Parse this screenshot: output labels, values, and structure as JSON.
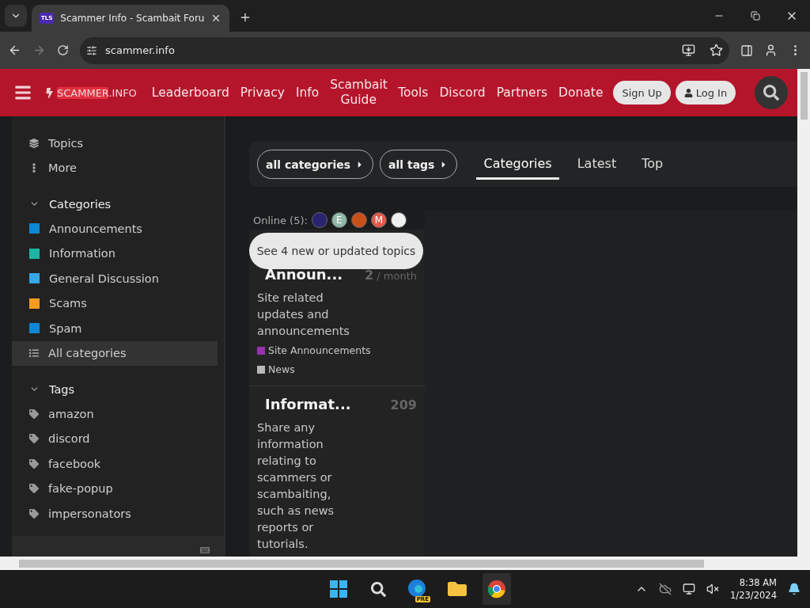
{
  "browser": {
    "tab": {
      "favicon": "TLS",
      "title": "Scammer Info - Scambait Foru",
      "selected": true
    },
    "url": "scammer.info"
  },
  "header": {
    "logo": {
      "highlight": "SCAMMER",
      "rest": ".INFO"
    },
    "nav": [
      "Leaderboard",
      "Privacy",
      "Info",
      "Scambait Guide",
      "Tools",
      "Discord",
      "Partners",
      "Donate"
    ],
    "buttons": [
      {
        "kind": "plain",
        "label": "Sign Up"
      },
      {
        "kind": "user",
        "label": "Log In"
      }
    ]
  },
  "sidebar": {
    "top": [
      {
        "kind": "layers",
        "label": "Topics"
      },
      {
        "kind": "more",
        "label": "More"
      }
    ],
    "categories": {
      "title": "Categories",
      "expanded": true,
      "items": [
        {
          "label": "Announcements",
          "color": "#0e87d6",
          "selected": false
        },
        {
          "label": "Information",
          "color": "#1fb5a4",
          "selected": false
        },
        {
          "label": "General Discussion",
          "color": "#34a8e8",
          "selected": false
        },
        {
          "label": "Scams",
          "color": "#f79a1e",
          "selected": false
        },
        {
          "label": "Spam",
          "color": "#0e87d6",
          "selected": false
        },
        {
          "label": "All categories",
          "kind": "list",
          "selected": true
        }
      ]
    },
    "tags": {
      "title": "Tags",
      "expanded": true,
      "items": [
        "amazon",
        "discord",
        "facebook",
        "fake-popup",
        "impersonators"
      ]
    }
  },
  "filters": [
    {
      "label": "all categories"
    },
    {
      "label": "all tags"
    }
  ],
  "tabs": [
    {
      "label": "Categories",
      "selected": true
    },
    {
      "label": "Latest",
      "selected": false
    },
    {
      "label": "Top",
      "selected": false
    }
  ],
  "online": {
    "label": "Online (5):",
    "avatars": [
      {
        "kind": "picture",
        "color": "#2a2470"
      },
      {
        "kind": "letter",
        "letter": "E",
        "color": "#8fb8a8"
      },
      {
        "kind": "picture",
        "color": "#c8501a"
      },
      {
        "kind": "letter",
        "letter": "M",
        "color": "#e45a4a"
      },
      {
        "kind": "picture",
        "color": "#f0f0f0"
      }
    ]
  },
  "notice": "See 4 new or updated topics",
  "cards": [
    {
      "title": "Announ...",
      "count": "2",
      "unit": "/ month",
      "description": "Site related updates and announcements",
      "subcategories": [
        {
          "label": "Site Announcements",
          "color": "#9b30b0"
        },
        {
          "label": "News",
          "color": "#b8b8b8"
        }
      ]
    },
    {
      "title": "Informat...",
      "count": "209",
      "description": "Share any information relating to scammers or scambaiting, such as news reports or tutorials."
    }
  ],
  "taskbar": {
    "time": "8:38 AM",
    "date": "1/23/2024",
    "edge_badge": "PRE"
  }
}
